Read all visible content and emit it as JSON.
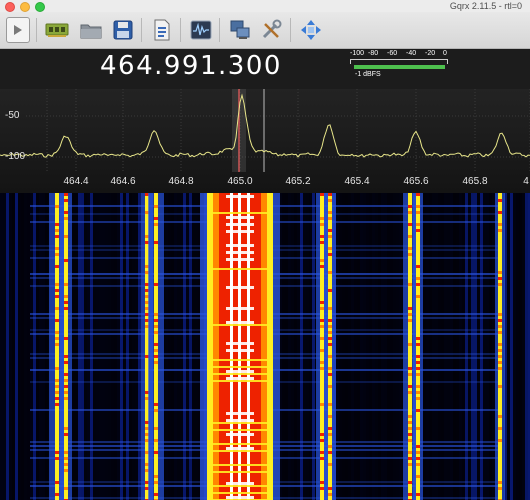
{
  "window": {
    "title": "Gqrx 2.11.5 - rtl=0"
  },
  "toolbar": {
    "buttons": [
      {
        "name": "start-dsp-button",
        "icon": "play-icon"
      },
      {
        "name": "configure-device-button",
        "icon": "hardware-board-icon"
      },
      {
        "name": "open-file-button",
        "icon": "folder-icon"
      },
      {
        "name": "save-settings-button",
        "icon": "floppy-disk-icon"
      },
      {
        "name": "load-settings-button",
        "icon": "document-icon"
      },
      {
        "name": "screenshot-button",
        "icon": "waveform-icon"
      },
      {
        "name": "remote-control-button",
        "icon": "network-computer-icon"
      },
      {
        "name": "settings-button",
        "icon": "tools-icon"
      },
      {
        "name": "fullscreen-button",
        "icon": "arrows-expand-icon"
      }
    ]
  },
  "frequency": {
    "display": "464.991.300"
  },
  "signal_meter": {
    "scale": [
      "-100",
      "-80",
      "-60",
      "-40",
      "-20",
      "0"
    ],
    "level_label": "-1 dBFS",
    "level_dbfs": -1,
    "bar_color": "#4ec04e"
  },
  "spectrum": {
    "db_labels": [
      "-50",
      "-100"
    ],
    "freq_ticks": [
      "464.4",
      "464.6",
      "464.8",
      "465.0",
      "465.2",
      "465.4",
      "465.6",
      "465.8",
      "4"
    ],
    "trace_color": "#e8e68a",
    "center_marker_color": "#cc5555"
  },
  "waterfall": {
    "palette": [
      "#000010",
      "#0a1e8c",
      "#2a55e0",
      "#ffee22",
      "#ff8800",
      "#ee2200",
      "#ffffff"
    ]
  }
}
